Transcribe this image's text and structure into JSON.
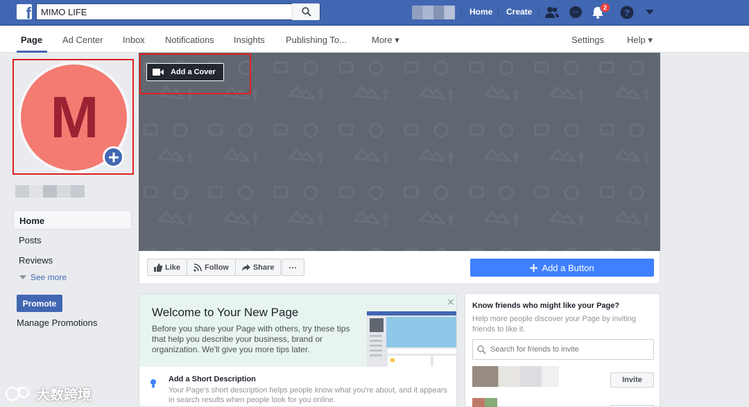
{
  "topbar": {
    "logo_glyph": "f",
    "search": {
      "value": "MIMO LIFE",
      "icon": "search-icon"
    },
    "links": {
      "home": "Home",
      "create": "Create"
    },
    "notification_count": "2",
    "icons": [
      "friends-icon",
      "messenger-icon",
      "bell-icon",
      "help-icon",
      "caret-down-icon"
    ]
  },
  "tabs": [
    "Page",
    "Ad Center",
    "Inbox",
    "Notifications",
    "Insights",
    "Publishing To...",
    "More ▾"
  ],
  "tabs_right": [
    "Settings",
    "Help ▾"
  ],
  "profile": {
    "letter": "M",
    "avatar_color": "#f37b72",
    "letter_color": "#9b2232"
  },
  "sidebar": {
    "items": [
      "Home",
      "Posts",
      "Reviews"
    ],
    "see_more": "See more",
    "promote": "Promote",
    "manage_promotions": "Manage Promotions"
  },
  "cover": {
    "add_cover": "Add a Cover"
  },
  "actions": {
    "like": "Like",
    "follow": "Follow",
    "share": "Share",
    "more": "···",
    "add_button": "Add a Button"
  },
  "welcome": {
    "title": "Welcome to Your New Page",
    "text": "Before you share your Page with others, try these tips that help you describe your business, brand or organization. We'll give you more tips later.",
    "close": "×",
    "tip_title": "Add a Short Description",
    "tip_desc": "Your Page's short description helps people know what you're about, and it appears in search results when people look for you online."
  },
  "invite": {
    "title": "Know friends who might like your Page?",
    "desc": "Help more people discover your Page by inviting friends to like it.",
    "search_placeholder": "Search for friends to invite",
    "invite_label": "Invite"
  },
  "watermark": "大数跨境",
  "colors": {
    "fb_blue": "#4267b2",
    "cta_blue": "#4080ff",
    "highlight_red": "#e02020",
    "cover_gray": "#606770"
  }
}
